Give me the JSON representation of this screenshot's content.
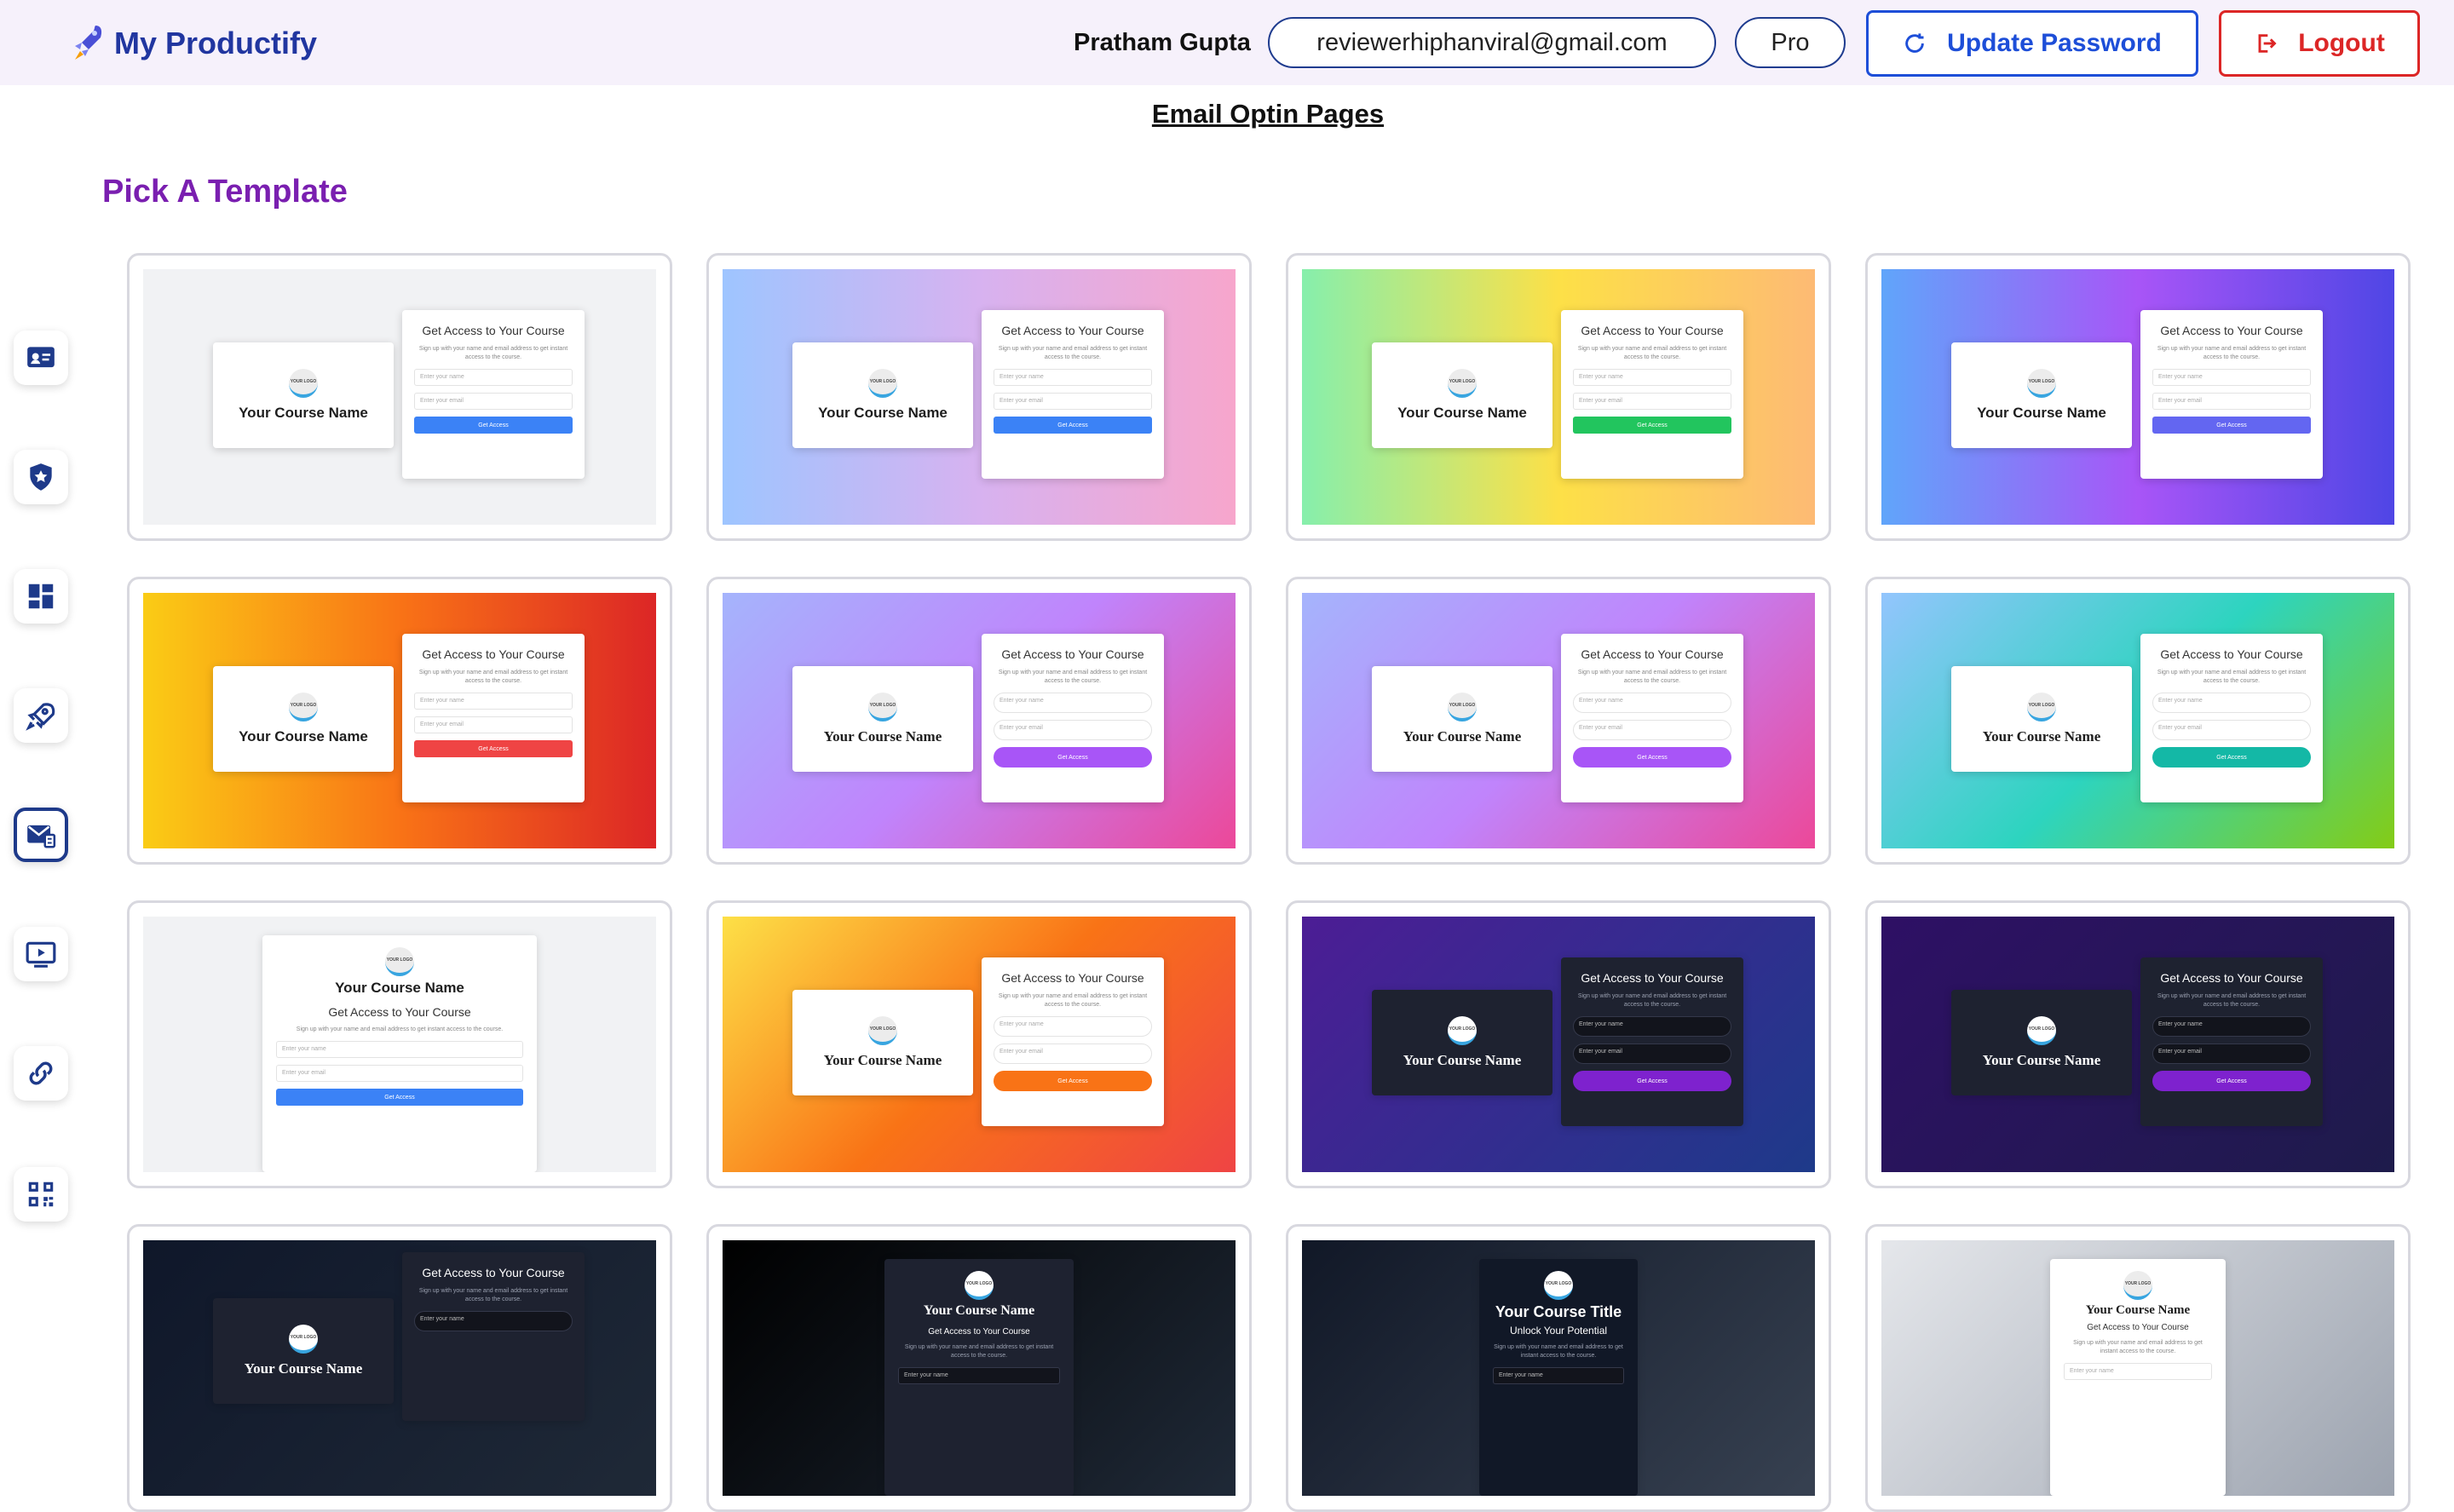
{
  "header": {
    "brand": "My Productify",
    "user_name": "Pratham Gupta",
    "email": "reviewerhiphanviral@gmail.com",
    "plan": "Pro",
    "update_password_label": "Update Password",
    "logout_label": "Logout"
  },
  "page_title": "Email Optin Pages",
  "section_title": "Pick A Template",
  "sidebar": {
    "items": [
      {
        "icon": "contact-card-icon"
      },
      {
        "icon": "shield-icon"
      },
      {
        "icon": "dashboard-grid-icon"
      },
      {
        "icon": "rocket-icon"
      },
      {
        "icon": "mail-page-icon",
        "active": true
      },
      {
        "icon": "video-play-icon"
      },
      {
        "icon": "link-icon"
      },
      {
        "icon": "qr-code-icon"
      }
    ]
  },
  "template_text": {
    "logo": "YOUR LOGO",
    "course_name": "Your Course Name",
    "form_title": "Get Access to Your Course",
    "form_sub": "Sign up with your name and email address to get instant access to the course.",
    "name_placeholder": "Enter your name",
    "email_placeholder": "Enter your email",
    "cta": "Get Access",
    "center_sub": "Get Access to Your Course",
    "course_title_alt": "Your Course Title",
    "unlock": "Unlock Your Potential"
  },
  "templates": [
    {
      "bg": "#f1f2f4",
      "cta_color": "#3b82f6"
    },
    {
      "bg": "linear-gradient(90deg,#9ec5ff,#d7b2f0,#f7a6cc)",
      "cta_color": "#3b82f6"
    },
    {
      "bg": "linear-gradient(90deg,#86efac,#fde047,#fdba74)",
      "cta_color": "#22c55e"
    },
    {
      "bg": "linear-gradient(90deg,#60a5fa,#a855f7,#4f46e5)",
      "cta_color": "#6366f1"
    },
    {
      "bg": "linear-gradient(90deg,#facc15,#f97316,#dc2626)",
      "cta_color": "#ef4444"
    },
    {
      "bg": "linear-gradient(135deg,#a5b4fc,#c084fc,#ec4899)",
      "cta_color": "#a855f7"
    },
    {
      "bg": "linear-gradient(135deg,#a5b4fc,#c084fc,#ec4899)",
      "cta_color": "#a855f7"
    },
    {
      "bg": "linear-gradient(135deg,#93c5fd,#2dd4bf,#84cc16)",
      "cta_color": "#14b8a6"
    },
    {
      "bg": "#f1f2f4",
      "cta_color": "#3b82f6"
    },
    {
      "bg": "linear-gradient(135deg,#fde047,#f97316,#ef4444)",
      "cta_color": "#f97316"
    },
    {
      "bg": "linear-gradient(135deg,#4c1d95,#1e3a8a)",
      "cta_color": "#7e22ce"
    },
    {
      "bg": "linear-gradient(135deg,#2e1065,#1e1b4b)",
      "cta_color": "#7e22ce"
    },
    {
      "bg": "linear-gradient(135deg,#0f172a,#1f2937)",
      "cta_color": "#7e22ce"
    },
    {
      "bg": "linear-gradient(135deg,#000000,#1f2937)",
      "cta_color": "#3b82f6"
    },
    {
      "bg": "linear-gradient(135deg,#111827,#374151)",
      "cta_color": "#3b82f6"
    },
    {
      "bg": "linear-gradient(135deg,#e5e7eb,#9ca3af)",
      "cta_color": "#3b82f6"
    }
  ]
}
